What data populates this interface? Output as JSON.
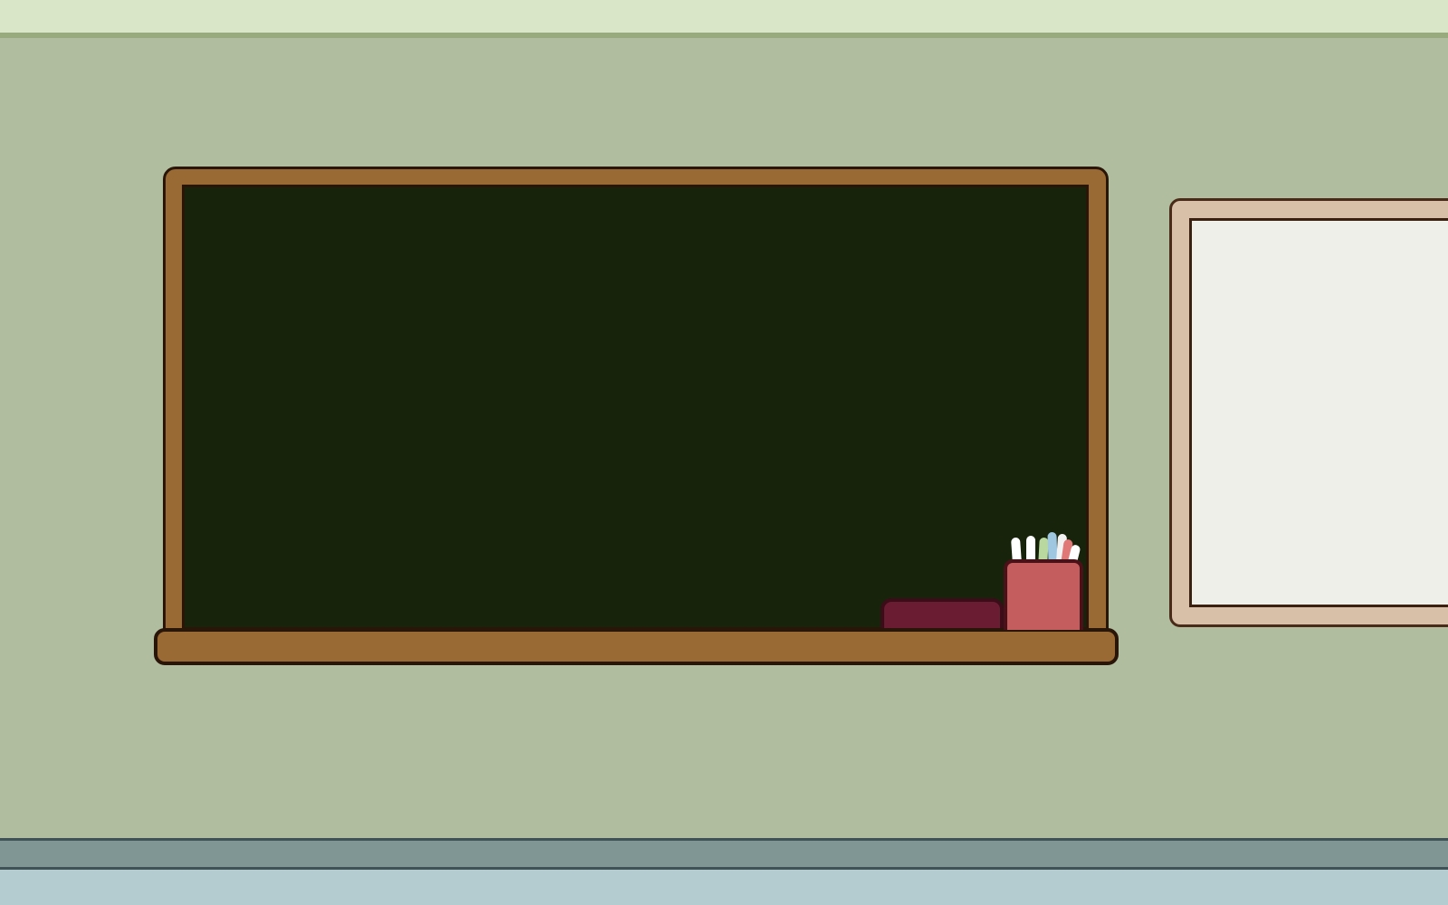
{
  "scene": {
    "colors": {
      "ceiling": "#d9e6c8",
      "ceiling_edge": "#98ab7e",
      "wall": "#b0bd9e",
      "baseboard": "#7f9694",
      "floor": "#b4cccf",
      "wood": "#9a6a34",
      "chalkboard": "#18230b",
      "eraser": "#6a1c32",
      "chalk_cup": "#c45e5e",
      "whiteboard_frame": "#d8bfa8",
      "whiteboard": "#efefea"
    },
    "chalk_colors": [
      "#ffffff",
      "#ffffff",
      "#b8d8a0",
      "#9fc8e0",
      "#f2f2f2",
      "#e07878",
      "#ffffff"
    ],
    "icons": {
      "chalkboard": "chalkboard-icon",
      "eraser": "eraser-icon",
      "chalk_cup": "chalk-cup-icon",
      "whiteboard": "whiteboard-icon"
    }
  }
}
